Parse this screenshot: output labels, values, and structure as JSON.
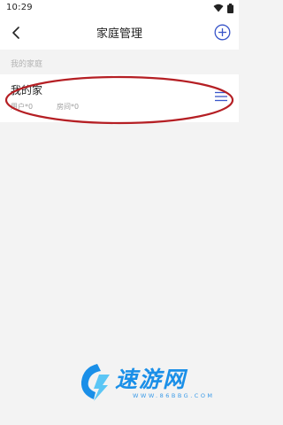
{
  "status_bar": {
    "time": "10:29"
  },
  "header": {
    "title": "家庭管理"
  },
  "section": {
    "label": "我的家庭"
  },
  "homes": [
    {
      "name": "我的家",
      "users": "用户*0",
      "rooms": "房间*0"
    }
  ],
  "watermark": {
    "brand": "速游网",
    "url": "WWW.86BBG.COM"
  },
  "colors": {
    "annotation": "#b51f24",
    "accent": "#3a56c9",
    "watermark": "#1a8fe8"
  },
  "icons": {
    "back": "chevron-left-icon",
    "add": "plus-circle-icon",
    "menu": "hamburger-menu-icon",
    "wifi": "wifi-icon",
    "battery": "battery-icon"
  }
}
